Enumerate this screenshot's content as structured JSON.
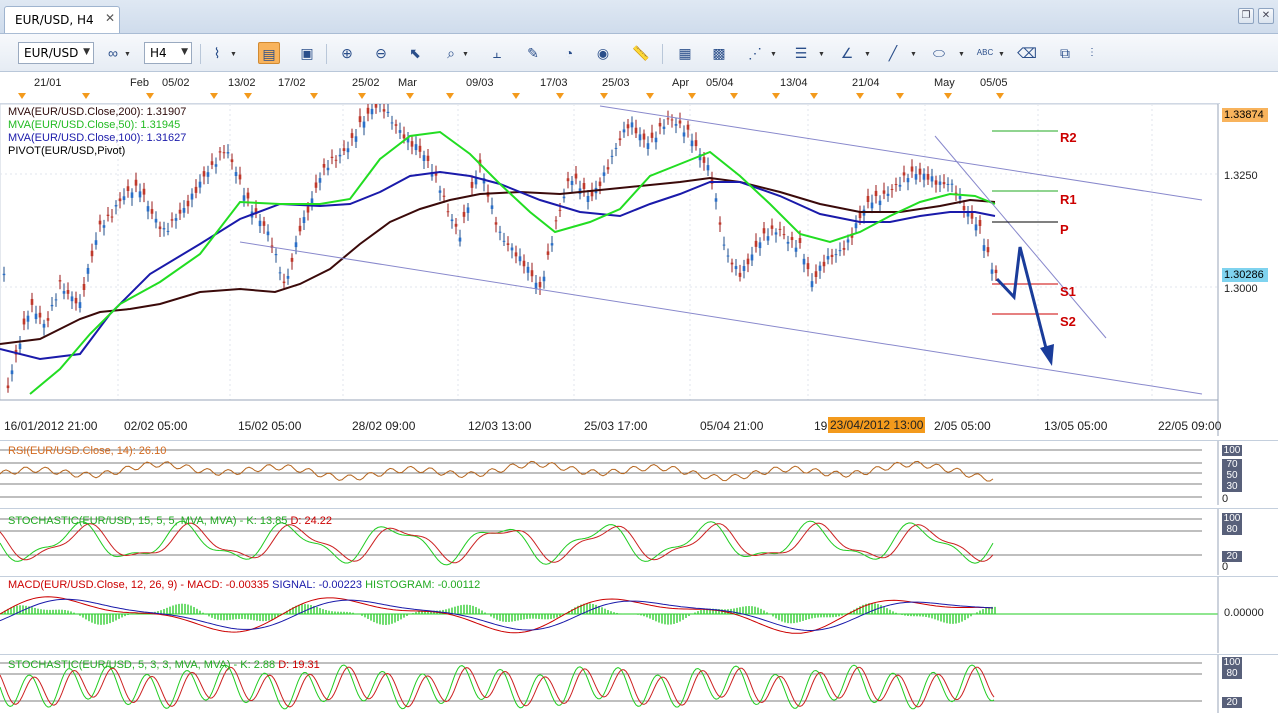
{
  "tab": {
    "title": "EUR/USD, H4"
  },
  "toolbar": {
    "symbol": "EUR/USD",
    "timeframe": "H4",
    "icons": [
      "line-chart-icon",
      "bar-chart-icon",
      "candle-chart-icon",
      "zoom-in-icon",
      "zoom-out-icon",
      "cursor-icon",
      "text-tool-icon",
      "draw-line-icon",
      "edit-icon",
      "magnet-icon",
      "globe-icon",
      "ruler-icon",
      "image-icon",
      "template-icon",
      "fibonacci-icon",
      "lines-icon",
      "pen-icon",
      "brush-icon",
      "ellipse-icon",
      "text-abc-icon",
      "eraser-icon",
      "objects-tree-icon"
    ]
  },
  "date_header": [
    "21/01",
    "Feb",
    "05/02",
    "13/02",
    "17/02",
    "25/02",
    "Mar",
    "09/03",
    "17/03",
    "25/03",
    "Apr",
    "05/04",
    "13/04",
    "21/04",
    "May",
    "05/05"
  ],
  "main_chart": {
    "legend": [
      {
        "label": "MVA(EUR/USD.Close,200): 1.31907",
        "color": "#3b0a0a"
      },
      {
        "label": "MVA(EUR/USD.Close,50): 1.31945",
        "color": "#22cc22"
      },
      {
        "label": "MVA(EUR/USD.Close,100): 1.31627",
        "color": "#1a1aaa"
      },
      {
        "label": "PIVOT(EUR/USD,Pivot)",
        "color": "#000000"
      }
    ],
    "price_ticks": [
      "1.3250",
      "1.3000"
    ],
    "price_top_tag": "1.33874",
    "price_current_tag": "1.30286",
    "pivots": [
      "R2",
      "R1",
      "P",
      "S1",
      "S2"
    ],
    "x_labels": [
      "16/01/2012 21:00",
      "02/02 05:00",
      "15/02 05:00",
      "28/02 09:00",
      "12/03 13:00",
      "25/03 17:00",
      "05/04 21:00",
      "19",
      "2/05 05:00",
      "13/05 05:00",
      "22/05 09:00"
    ],
    "x_highlight": "23/04/2012 13:00"
  },
  "rsi": {
    "title": "RSI(EUR/USD.Close, 14): 26.10",
    "ticks": [
      "100",
      "70",
      "50",
      "30",
      "0"
    ]
  },
  "stoch1": {
    "title": "STOCHASTIC(EUR/USD, 15, 5, 5, MVA, MVA) -",
    "k": "K: 13.85",
    "d": "D: 24.22",
    "ticks": [
      "100",
      "80",
      "20",
      "0"
    ]
  },
  "macd": {
    "title": "MACD(EUR/USD.Close, 12, 26, 9) -",
    "macd": "MACD: -0.00335",
    "signal": "SIGNAL: -0.00223",
    "histogram": "HISTOGRAM: -0.00112",
    "tick": "0.00000"
  },
  "stoch2": {
    "title": "STOCHASTIC(EUR/USD, 5, 3, 3, MVA, MVA) -",
    "k": "K: 2.88",
    "d": "D: 19.31",
    "ticks": [
      "100",
      "80",
      "20"
    ]
  }
}
